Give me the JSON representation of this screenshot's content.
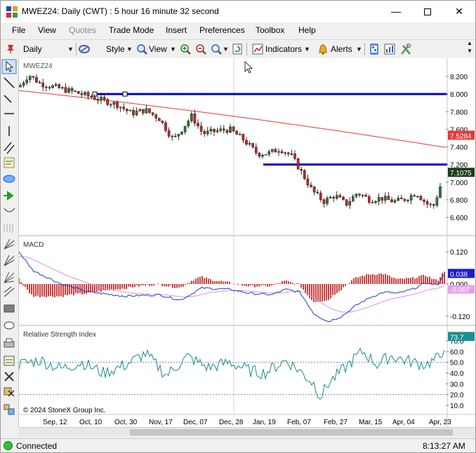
{
  "window": {
    "title": "MWEZ24: Daily (CWT) : 5 hour 16 minute 32 second",
    "min_icon": "minimize-icon",
    "max_icon": "maximize-icon",
    "close_icon": "close-icon"
  },
  "menu": [
    "File",
    "View",
    "Quotes",
    "Trade Mode",
    "Insert",
    "Preferences",
    "Toolbox",
    "Help"
  ],
  "toolbar": {
    "period": "Daily",
    "style": "Style",
    "view": "View",
    "indicators": "Indicators",
    "alerts": "Alerts"
  },
  "chart": {
    "symbol": "MWEZ24",
    "copyright": "© 2024 StoneX Group Inc.",
    "price_axis": [
      "8.200",
      "8.000",
      "7.800",
      "7.600",
      "7.400",
      "7.200",
      "7.000",
      "6.800",
      "6.600"
    ],
    "price_ma_label": "7.5284",
    "price_last_label": "7.1075",
    "x_labels": [
      "Sep, 12",
      "Oct, 10",
      "Oct, 30",
      "Nov, 17",
      "Dec, 07",
      "Dec, 28",
      "Jan, 19",
      "Feb, 07",
      "Feb, 27",
      "Mar, 15",
      "Apr, 04",
      "Apr, 23"
    ],
    "macd": {
      "title": "MACD",
      "axis": [
        "0.120",
        "0.000",
        "-0.120"
      ],
      "macd_label": "0.038",
      "signal_label": "-0.007"
    },
    "rsi": {
      "title": "Relative Strength Index",
      "axis": [
        "70.0",
        "60.0",
        "50.0",
        "40.0",
        "30.0",
        "20.0",
        "10.0"
      ],
      "last_label": "73.7"
    },
    "colors": {
      "up": "#2e7d32",
      "down": "#c62828",
      "hline": "#0000cc",
      "ma": "#e53935",
      "macd": "#1e3cc8",
      "signal": "#e090e0",
      "rsi": "#1a8a8a",
      "last": "#1b3b1b"
    }
  },
  "status": {
    "connection": "Connected",
    "time": "8:13:27 AM"
  }
}
